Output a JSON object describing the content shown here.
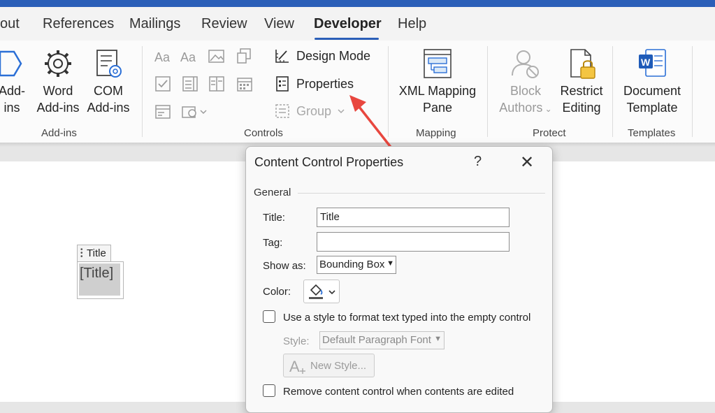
{
  "tabs": [
    {
      "label": "out"
    },
    {
      "label": "References"
    },
    {
      "label": "Mailings"
    },
    {
      "label": "Review"
    },
    {
      "label": "View"
    },
    {
      "label": "Developer",
      "active": true
    },
    {
      "label": "Help"
    }
  ],
  "ribbon": {
    "addins": {
      "group_label": "Add-ins",
      "btn1": {
        "line1": "Add-",
        "line2": "ins"
      },
      "btn2": {
        "line1": "Word",
        "line2": "Add-ins"
      },
      "btn3": {
        "line1": "COM",
        "line2": "Add-ins"
      }
    },
    "controls": {
      "group_label": "Controls",
      "design_mode": "Design Mode",
      "properties": "Properties",
      "group": "Group"
    },
    "mapping": {
      "group_label": "Mapping",
      "xml_line1": "XML Mapping",
      "xml_line2": "Pane"
    },
    "protect": {
      "group_label": "Protect",
      "block_line1": "Block",
      "block_line2": "Authors",
      "restrict_line1": "Restrict",
      "restrict_line2": "Editing"
    },
    "templates": {
      "group_label": "Templates",
      "doc_line1": "Document",
      "doc_line2": "Template"
    }
  },
  "document": {
    "cc_tab_label": "Title",
    "cc_placeholder": "[Title]"
  },
  "dialog": {
    "title": "Content Control Properties",
    "help": "?",
    "close": "✕",
    "section": "General",
    "title_label": "Title:",
    "title_value": "Title",
    "tag_label": "Tag:",
    "tag_value": "",
    "show_as_label": "Show as:",
    "show_as_value": "Bounding Box",
    "color_label": "Color:",
    "use_style_label": "Use a style to format text typed into the empty control",
    "style_label": "Style:",
    "style_value": "Default Paragraph Font",
    "new_style_label": "New Style...",
    "remove_label": "Remove content control when contents are edited"
  },
  "colors": {
    "accent": "#2b5fb8",
    "arrow": "#e8473f"
  }
}
